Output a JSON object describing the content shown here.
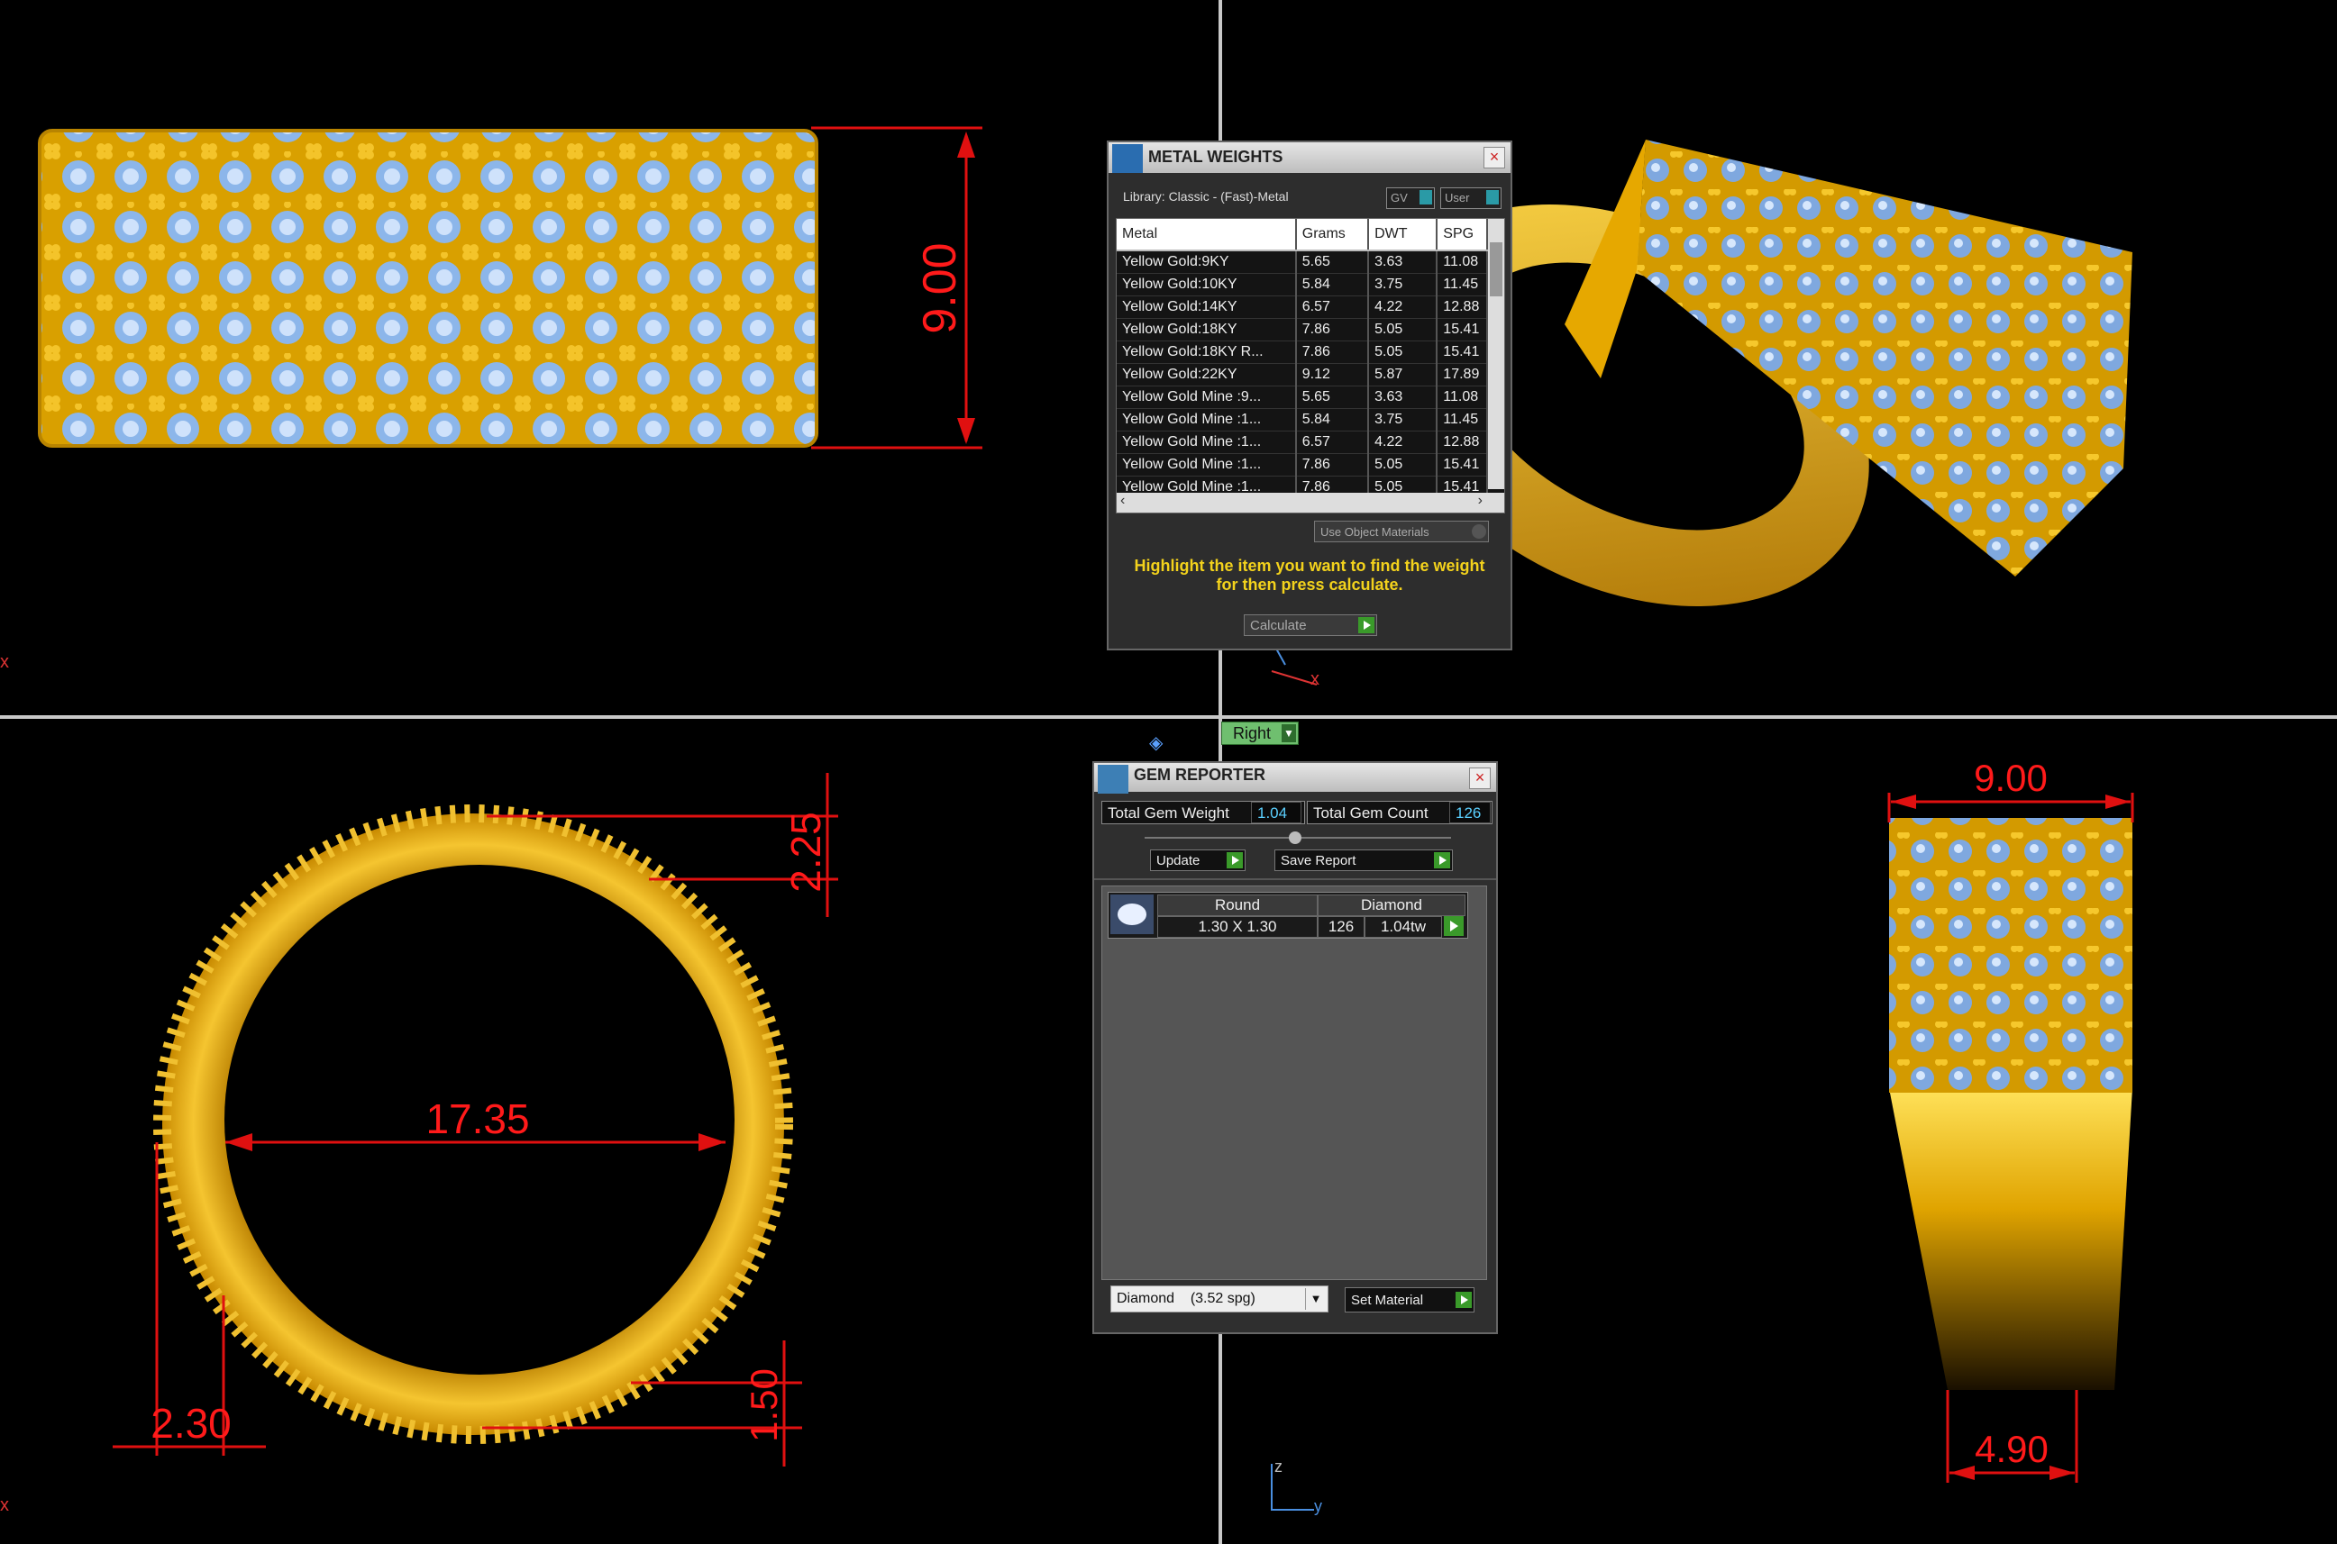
{
  "viewports": {
    "top_left": {
      "dimension": "9.00",
      "axis_label": "x"
    },
    "bottom_left": {
      "dim_diameter": "17.35",
      "dim_top": "2.25",
      "dim_left": "2.30",
      "dim_bottom_right": "1.50",
      "axis_label": "x"
    },
    "bottom_right": {
      "dim_top": "9.00",
      "dim_bottom": "4.90"
    },
    "top_right_axis": {
      "x": "x"
    },
    "bottom_axis": {
      "z": "z",
      "y": "y"
    },
    "view_dropdown": "Right"
  },
  "metal_weights": {
    "title": "METAL WEIGHTS",
    "library": "Library: Classic - (Fast)-Metal",
    "gv_label": "GV",
    "user_label": "User",
    "columns": [
      "Metal",
      "Grams",
      "DWT",
      "SPG"
    ],
    "rows": [
      [
        "Yellow Gold:9KY",
        "5.65",
        "3.63",
        "11.08"
      ],
      [
        "Yellow Gold:10KY",
        "5.84",
        "3.75",
        "11.45"
      ],
      [
        "Yellow Gold:14KY",
        "6.57",
        "4.22",
        "12.88"
      ],
      [
        "Yellow Gold:18KY",
        "7.86",
        "5.05",
        "15.41"
      ],
      [
        "Yellow Gold:18KY R...",
        "7.86",
        "5.05",
        "15.41"
      ],
      [
        "Yellow Gold:22KY",
        "9.12",
        "5.87",
        "17.89"
      ],
      [
        "Yellow Gold Mine :9...",
        "5.65",
        "3.63",
        "11.08"
      ],
      [
        "Yellow Gold Mine :1...",
        "5.84",
        "3.75",
        "11.45"
      ],
      [
        "Yellow Gold Mine :1...",
        "6.57",
        "4.22",
        "12.88"
      ],
      [
        "Yellow Gold Mine :1...",
        "7.86",
        "5.05",
        "15.41"
      ],
      [
        "Yellow Gold Mine :1...",
        "7.86",
        "5.05",
        "15.41"
      ]
    ],
    "use_object_materials": "Use Object Materials",
    "instruction_line1": "Highlight the item you want to find the weight",
    "instruction_line2": "for then press calculate.",
    "calculate_label": "Calculate"
  },
  "gem_reporter": {
    "title": "GEM REPORTER",
    "total_weight_label": "Total Gem Weight",
    "total_weight_value": "1.04",
    "total_count_label": "Total Gem Count",
    "total_count_value": "126",
    "update_label": "Update",
    "save_report_label": "Save Report",
    "gem_shape": "Round",
    "gem_type": "Diamond",
    "gem_size": "1.30 X 1.30",
    "gem_count": "126",
    "gem_weight": "1.04tw",
    "material_select": "Diamond    (3.52 spg)",
    "set_material_label": "Set Material"
  },
  "colors": {
    "gold": "#e0a800",
    "gem": "#8ab4e8",
    "dimension_red": "#e01010"
  }
}
